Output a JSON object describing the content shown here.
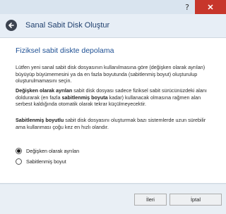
{
  "window": {
    "help_label": "?",
    "close_label": "✕"
  },
  "header": {
    "title": "Sanal Sabit Disk Oluştur"
  },
  "section": {
    "title": "Fiziksel sabit diskte depolama"
  },
  "paragraphs": {
    "intro": "Lütfen yeni sanal sabit disk dosyasının kullanılmasına göre (değişken olarak ayrılan) büyüyüp büyümemesini ya da en fazla boyutunda (sabitlenmiş boyut) oluşturulup oluşturulmamasını seçin.",
    "dynamic_bold": "Değişken olarak ayrılan",
    "dynamic_text_1": " sabit disk dosyası sadece fiziksel sabit sürücünüzdeki alanı doldurarak (en fazla ",
    "dynamic_bold_2": "sabitlenmiş boyuta",
    "dynamic_text_2": " kadar) kullanacak olmasına rağmen alan serbest kaldığında otomatik olarak tekrar küçülmeyecektir.",
    "fixed_bold": "Sabitlenmiş boyutlu",
    "fixed_text": " sabit disk dosyasını oluşturmak bazı sistemlerde uzun sürebilir ama kullanması çoğu kez en hızlı olandır."
  },
  "options": [
    {
      "label": "Değişken olarak ayrılan",
      "selected": true
    },
    {
      "label": "Sabitlenmiş boyut",
      "selected": false
    }
  ],
  "buttons": {
    "next": "İleri",
    "cancel": "İptal"
  }
}
